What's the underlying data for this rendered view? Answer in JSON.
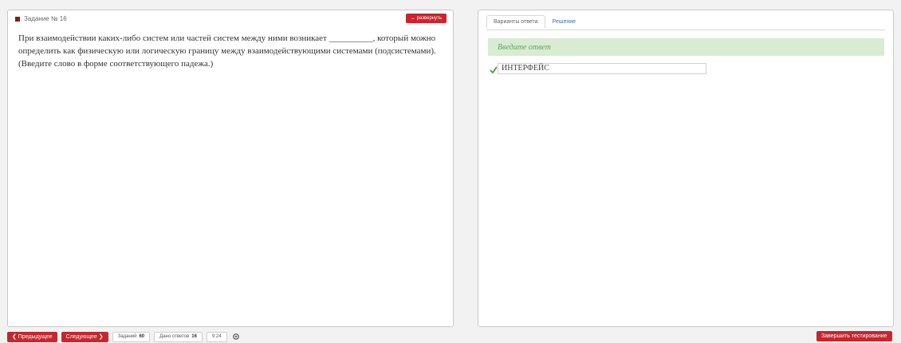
{
  "left": {
    "task_label": "Задание № 16",
    "expand_label": "↔ развернуть",
    "question": "При взаимодействии каких-либо систем или частей систем между ними возникает __________, который можно определить как физическую или логическую границу между взаимодействующими системами (подсистемами). (Введите слово в форме соответствующего падежа.)"
  },
  "right": {
    "tabs": [
      "Варианты ответа",
      "Решение"
    ],
    "answer_header": "Введите ответ",
    "answer_value": "ИНТЕРФЕЙС"
  },
  "bottom": {
    "prev_label": "❮ Предыдущее",
    "next_label": "Следующее ❯",
    "tasks_label": "Заданий",
    "tasks_count": "60",
    "answered_label": "Дано ответов",
    "answered_count": "16",
    "timer": "9:24",
    "finish_label": "Завершить тестирование"
  },
  "colors": {
    "accent": "#c9252c",
    "answer_bg": "#d7ecd1",
    "answer_text": "#6aa35e",
    "link": "#3b6fb6"
  }
}
